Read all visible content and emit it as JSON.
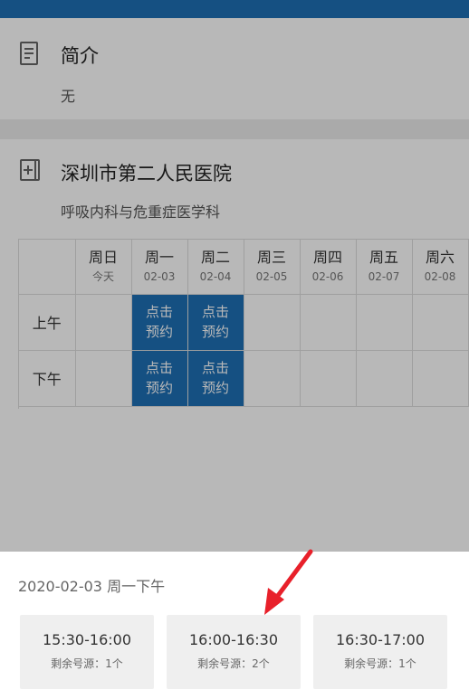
{
  "intro": {
    "title": "简介",
    "value": "无"
  },
  "hospital": {
    "name": "深圳市第二人民医院",
    "department": "呼吸内科与危重症医学科"
  },
  "schedule": {
    "days": [
      {
        "weekday": "周日",
        "date": "今天"
      },
      {
        "weekday": "周一",
        "date": "02-03"
      },
      {
        "weekday": "周二",
        "date": "02-04"
      },
      {
        "weekday": "周三",
        "date": "02-05"
      },
      {
        "weekday": "周四",
        "date": "02-06"
      },
      {
        "weekday": "周五",
        "date": "02-07"
      },
      {
        "weekday": "周六",
        "date": "02-08"
      }
    ],
    "periods": [
      "上午",
      "下午"
    ],
    "book_line1": "点击",
    "book_line2": "预约"
  },
  "sheet": {
    "title": "2020-02-03 周一下午",
    "slots": [
      {
        "time": "15:30-16:00",
        "remain": "剩余号源：1个"
      },
      {
        "time": "16:00-16:30",
        "remain": "剩余号源：2个"
      },
      {
        "time": "16:30-17:00",
        "remain": "剩余号源：1个"
      }
    ]
  },
  "colors": {
    "accent": "#1e6fb5",
    "arrow": "#e8202a"
  }
}
